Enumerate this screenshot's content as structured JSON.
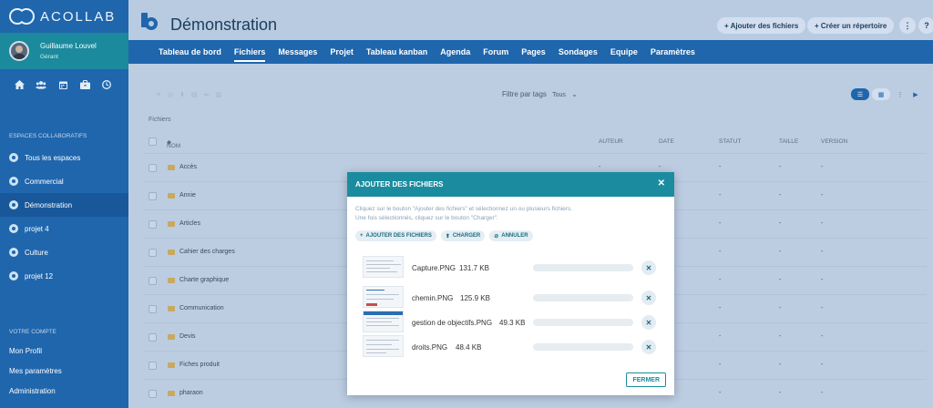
{
  "brand": {
    "name": "ACOLLAB"
  },
  "user": {
    "name": "Guillaume Louvel",
    "role": "Gérant"
  },
  "quick_icons": [
    "home-icon",
    "users-icon",
    "calendar-icon",
    "briefcase-icon",
    "clock-icon"
  ],
  "sidebar": {
    "spaces_title": "ESPACES COLLABORATIFS",
    "spaces": [
      {
        "label": "Tous les espaces"
      },
      {
        "label": "Commercial"
      },
      {
        "label": "Démonstration"
      },
      {
        "label": "projet 4"
      },
      {
        "label": "Culture"
      },
      {
        "label": "projet 12"
      }
    ],
    "account_title": "VOTRE COMPTE",
    "account": [
      {
        "label": "Mon Profil"
      },
      {
        "label": "Mes paramètres"
      },
      {
        "label": "Administration"
      }
    ]
  },
  "header": {
    "title": "Démonstration",
    "add_files": "+ Ajouter des fichiers",
    "create_dir": "+ Créer un répertoire",
    "more": "⋮",
    "help": "?"
  },
  "tabs": [
    {
      "label": "Tableau de bord"
    },
    {
      "label": "Fichiers"
    },
    {
      "label": "Messages"
    },
    {
      "label": "Projet"
    },
    {
      "label": "Tableau kanban"
    },
    {
      "label": "Agenda"
    },
    {
      "label": "Forum"
    },
    {
      "label": "Pages"
    },
    {
      "label": "Sondages"
    },
    {
      "label": "Equipe"
    },
    {
      "label": "Paramètres"
    }
  ],
  "toolbar": {
    "filter_label": "Filtre par tags",
    "filter_value": "Tous"
  },
  "files": {
    "label": "Fichiers",
    "columns": {
      "name": "NOM",
      "author": "AUTEUR",
      "date": "DATE",
      "status": "STATUT",
      "size": "TAILLE",
      "version": "VERSION"
    },
    "rows": [
      {
        "name": "Accès"
      },
      {
        "name": "Annie"
      },
      {
        "name": "Articles"
      },
      {
        "name": "Cahier des charges"
      },
      {
        "name": "Charte graphique"
      },
      {
        "name": "Communication"
      },
      {
        "name": "Devis"
      },
      {
        "name": "Fiches produit"
      },
      {
        "name": "pharaon"
      }
    ],
    "dash": "-"
  },
  "modal": {
    "title": "AJOUTER DES FICHIERS",
    "help_line1": "Cliquez sur le bouton \"Ajouter des fichiers\" et sélectionnez un ou plusieurs fichiers.",
    "help_line2": "Une fois sélectionnés, cliquez sur le bouton \"Charger\".",
    "btn_add": "AJOUTER DES FICHIERS",
    "btn_upload": "CHARGER",
    "btn_cancel": "ANNULER",
    "close": "FERMER",
    "files": [
      {
        "name": "Capture.PNG",
        "size": "131.7 KB",
        "progress": 0
      },
      {
        "name": "chemin.PNG",
        "size": "125.9 KB",
        "progress": 0
      },
      {
        "name": "gestion de objectifs.PNG",
        "size": "49.3 KB",
        "progress": 0
      },
      {
        "name": "droits.PNG",
        "size": "48.4 KB",
        "progress": 0
      }
    ]
  }
}
